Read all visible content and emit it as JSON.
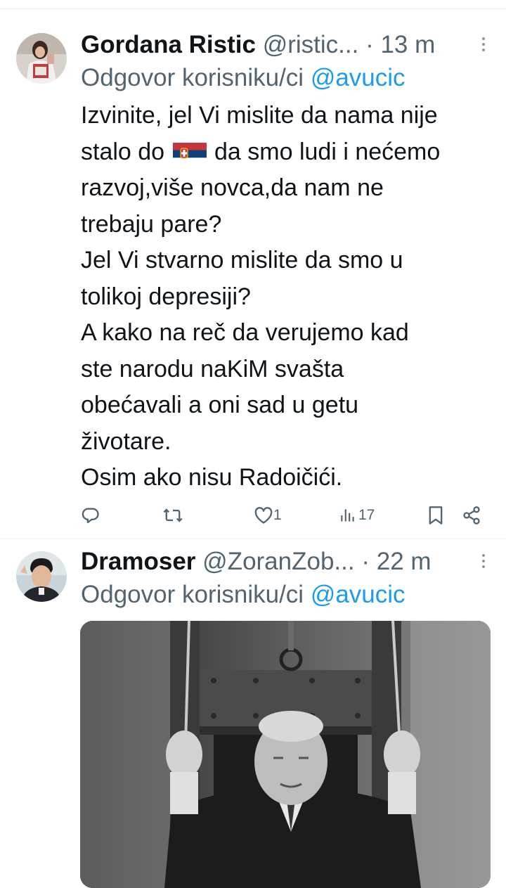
{
  "tweets": [
    {
      "name": "Gordana Ristic",
      "handle": "@ristic...",
      "dot": "·",
      "time": "13 m",
      "reply_prefix": "Odgovor korisniku/ci",
      "reply_mention": "@avucic",
      "lines": [
        "Izvinite, jel Vi mislite da nama nije",
        "stalo do",
        "da smo ludi i nećemo",
        "razvoj,više novca,da nam ne",
        "trebaju pare?",
        "Jel Vi stvarno mislite da smo u",
        "tolikoj depresiji?",
        "A kako na reč da verujemo kad",
        "ste narodu naKiM svašta",
        "obećavali a oni sad u getu",
        "životare.",
        "Osim ako nisu Radoičići."
      ],
      "likes": "1",
      "views": "17"
    },
    {
      "name": "Dramoser",
      "handle": "@ZoranZob...",
      "dot": "·",
      "time": "22 m",
      "reply_prefix": "Odgovor korisniku/ci",
      "reply_mention": "@avucic"
    }
  ],
  "icons": {
    "reply": "reply-icon",
    "retweet": "retweet-icon",
    "like": "heart-icon",
    "views": "views-icon",
    "bookmark": "bookmark-icon",
    "share": "share-icon",
    "more": "more-icon",
    "flag": "serbia-flag-icon"
  },
  "colors": {
    "link": "#1d9bf0",
    "secondary": "#536471"
  }
}
